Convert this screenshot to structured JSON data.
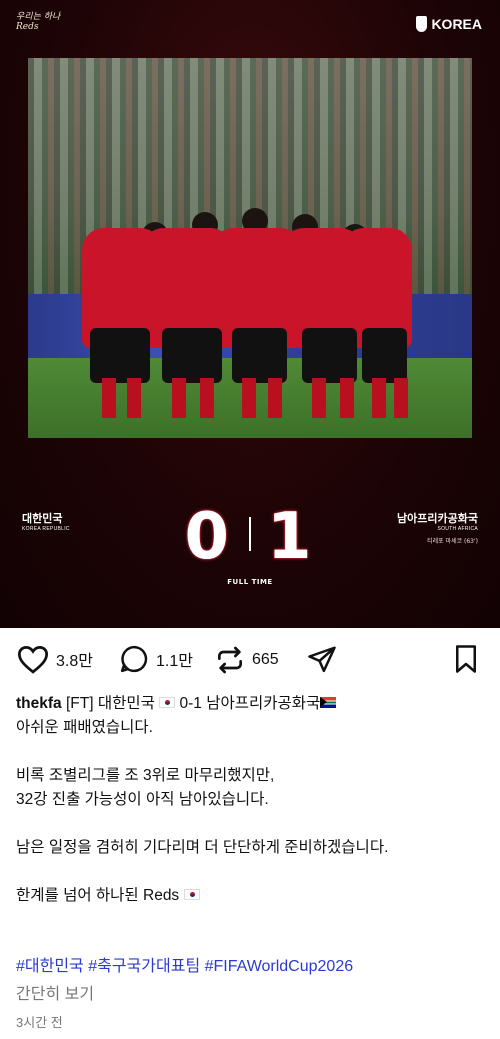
{
  "post_image": {
    "logo_text": "우리는 하나 Reds",
    "kfa_label": "KOREA",
    "home_team": {
      "name_kr": "대한민국",
      "name_en": "KOREA REPUBLIC"
    },
    "away_team": {
      "name_kr": "남아프리카공화국",
      "name_en": "SOUTH AFRICA"
    },
    "score_home": "0",
    "score_away": "1",
    "scorer": "티레포 마세코 (63')",
    "status": "FULL TIME"
  },
  "actions": {
    "likes": "3.8만",
    "comments": "1.1만",
    "reposts": "665"
  },
  "caption": {
    "username": "thekfa",
    "line1_rest": "[FT] 대한민국",
    "line1_score": "0-1 남아프리카공화국",
    "line2": "아쉬운 패배였습니다.",
    "line3": "비록 조별리그를 조 3위로 마무리했지만,",
    "line4": "32강 진출 가능성이 아직 남아있습니다.",
    "line5": "남은 일정을 겸허히 기다리며 더 단단하게 준비하겠습니다.",
    "line6": "한계를 넘어 하나된 Reds"
  },
  "hashtags": "#대한민국 #축구국가대표팀 #FIFAWorldCup2026",
  "more_label": "간단히 보기",
  "timestamp": "3시간 전"
}
